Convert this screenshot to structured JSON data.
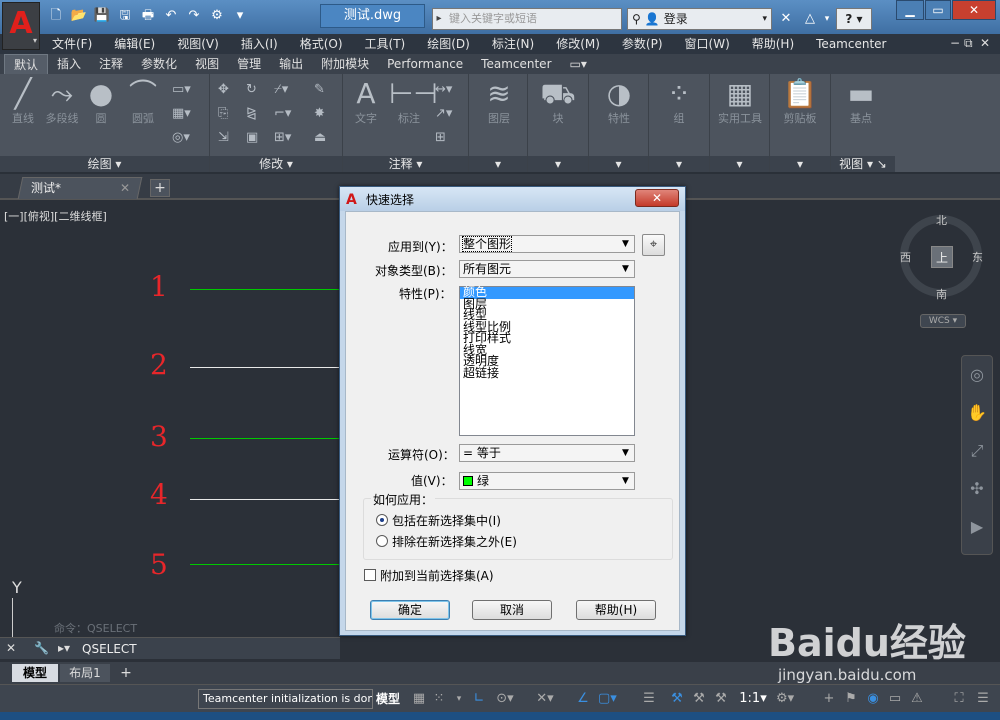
{
  "titlebar": {
    "doc_title": "测试.dwg",
    "search_placeholder": "键入关键字或短语",
    "login_label": "登录",
    "help_label": "?"
  },
  "menubar": {
    "items": [
      "文件(F)",
      "编辑(E)",
      "视图(V)",
      "插入(I)",
      "格式(O)",
      "工具(T)",
      "绘图(D)",
      "标注(N)",
      "修改(M)",
      "参数(P)",
      "窗口(W)",
      "帮助(H)",
      "Teamcenter"
    ]
  },
  "ribbon": {
    "tabs": [
      "默认",
      "插入",
      "注释",
      "参数化",
      "视图",
      "管理",
      "输出",
      "附加模块",
      "Performance",
      "Teamcenter"
    ],
    "draw": {
      "title": "绘图",
      "buttons": [
        "直线",
        "多段线",
        "圆",
        "圆弧"
      ]
    },
    "modify": {
      "title": "修改"
    },
    "annotation": {
      "title": "注释",
      "buttons": [
        "文字",
        "标注"
      ]
    },
    "layer": {
      "label": "图层"
    },
    "block": {
      "label": "块"
    },
    "properties": {
      "label": "特性"
    },
    "group": {
      "label": "组"
    },
    "utilities": {
      "label": "实用工具"
    },
    "clipboard": {
      "label": "剪贴板"
    },
    "base": {
      "label": "基点"
    },
    "view_panel": {
      "title": "视图"
    }
  },
  "filetabs": {
    "active": "测试*"
  },
  "canvas": {
    "view_label": "[一][俯视][二维线框]",
    "numbers": [
      "1",
      "2",
      "3",
      "4",
      "5"
    ],
    "line_colors": [
      "#00c800",
      "#e8e8e8",
      "#00c800",
      "#e8e8e8",
      "#00c800"
    ],
    "compass": {
      "north": "北",
      "south": "南",
      "east": "东",
      "west": "西",
      "center": "上"
    },
    "wcs": "WCS",
    "ucs_y": "Y",
    "command_history": "命令：QSELECT"
  },
  "cmdline": {
    "text": "QSELECT"
  },
  "layouts": {
    "model": "模型",
    "layout1": "布局1"
  },
  "statusbar": {
    "message": "Teamcenter initialization is done",
    "model": "模型",
    "scale": "1:1"
  },
  "dialog": {
    "title": "快速选择",
    "apply_to_label": "应用到(Y)：",
    "apply_to_value": "整个图形",
    "object_type_label": "对象类型(B)：",
    "object_type_value": "所有图元",
    "properties_label": "特性(P)：",
    "properties": [
      "颜色",
      "图层",
      "线型",
      "线型比例",
      "打印样式",
      "线宽",
      "透明度",
      "超链接"
    ],
    "operator_label": "运算符(O)：",
    "operator_value": "= 等于",
    "value_label": "值(V)：",
    "value_value": "绿",
    "value_color": "#00ff00",
    "how_apply_label": "如何应用：",
    "include_label": "包括在新选择集中(I)",
    "exclude_label": "排除在新选择集之外(E)",
    "append_label": "附加到当前选择集(A)",
    "ok_label": "确定",
    "cancel_label": "取消",
    "help_label": "帮助(H)"
  },
  "watermark": {
    "brand": "Baidu经验",
    "url": "jingyan.baidu.com"
  }
}
